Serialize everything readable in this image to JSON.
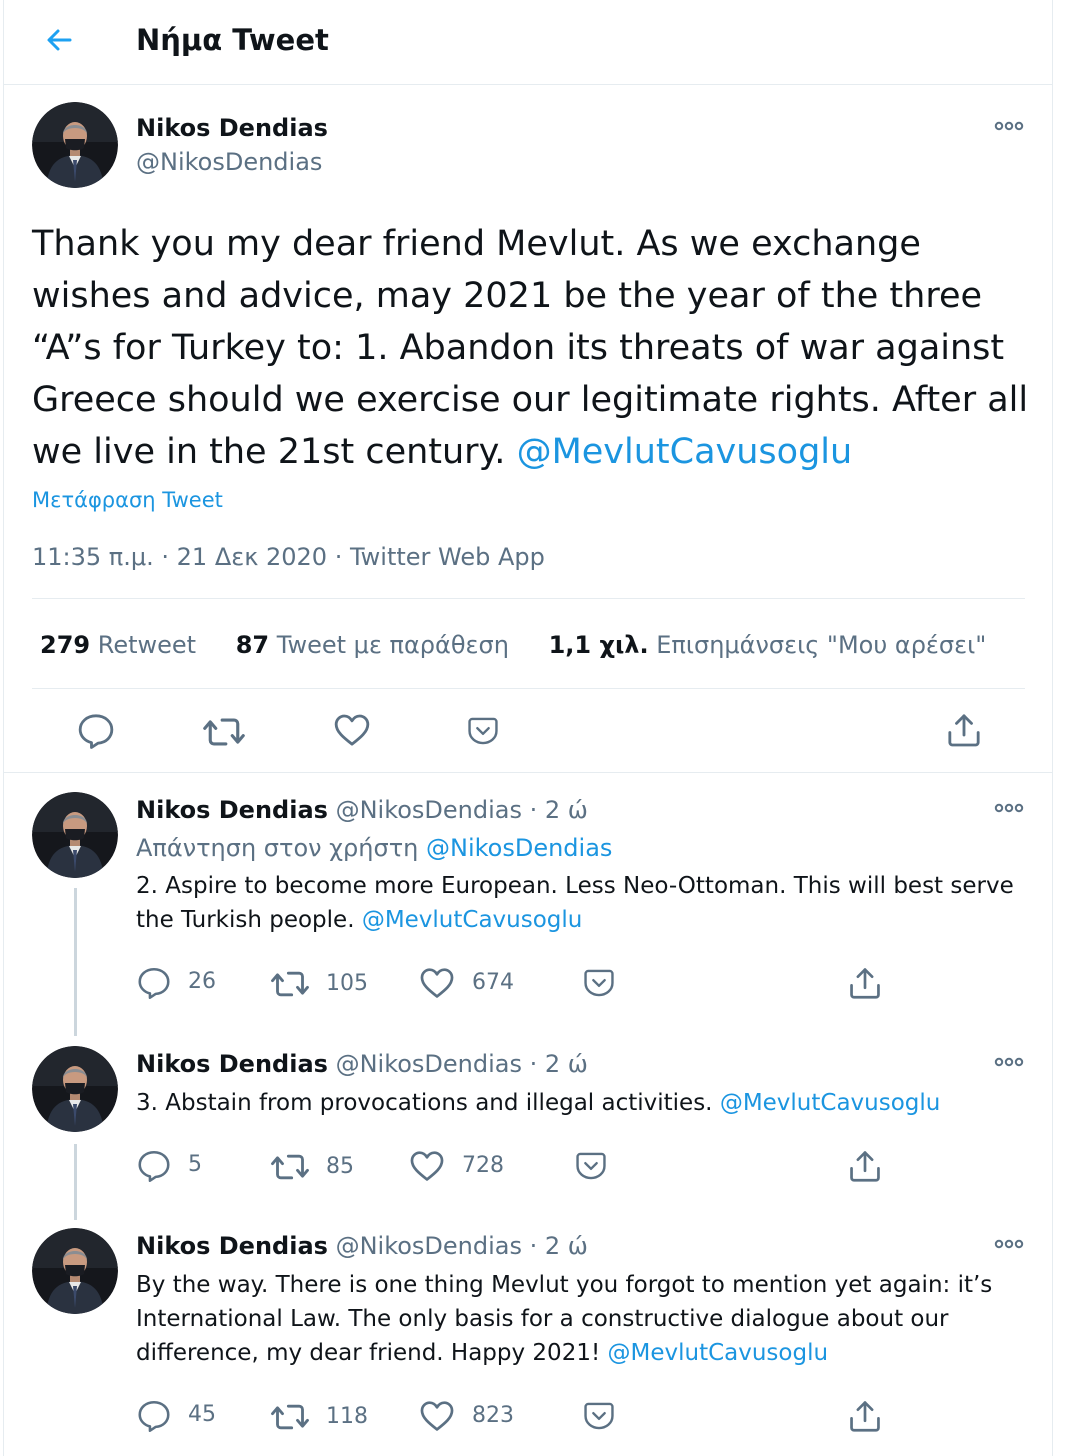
{
  "header": {
    "title": "Νήμα Tweet",
    "back_icon": "arrow-left-icon"
  },
  "colors": {
    "accent": "#1da1f2",
    "link": "#1b95e0",
    "secondary_text": "#5b7083",
    "divider": "#e6ecf0"
  },
  "main_tweet": {
    "author_name": "Nikos Dendias",
    "author_handle": "@NikosDendias",
    "text": "Thank you my dear friend Mevlut. As we exchange wishes and advice, may 2021 be the year of the three “A”s for Turkey to: 1. Abandon its threats of war against Greece should we exercise our legitimate rights. After all we live in the 21st century. ",
    "mention": "@MevlutCavusoglu",
    "translate_label": "Μετάφραση Tweet",
    "timestamp": "11:35 π.μ. · 21 Δεκ 2020 · Twitter Web App",
    "stats": {
      "retweets_count": "279",
      "retweets_label": "Retweet",
      "quotes_count": "87",
      "quotes_label": "Tweet με παράθεση",
      "likes_count": "1,1 χιλ.",
      "likes_label": "Επισημάνσεις \"Μου αρέσει\""
    }
  },
  "replies": [
    {
      "author_name": "Nikos Dendias",
      "author_handle": "@NikosDendias",
      "time": " · 2 ώ",
      "reply_to_label": "Απάντηση στον χρήστη ",
      "reply_to_handle": "@NikosDendias",
      "text": "2. Aspire to become more European. Less Neo-Ottoman. This will best serve the Turkish people. ",
      "mention": "@MevlutCavusoglu",
      "replies_count": "26",
      "retweets_count": "105",
      "likes_count": "674"
    },
    {
      "author_name": "Nikos Dendias",
      "author_handle": "@NikosDendias",
      "time": " · 2 ώ",
      "text": "3. Abstain from provocations and illegal activities. ",
      "mention": "@MevlutCavusoglu",
      "replies_count": "5",
      "retweets_count": "85",
      "likes_count": "728"
    },
    {
      "author_name": "Nikos Dendias",
      "author_handle": "@NikosDendias",
      "time": " · 2 ώ",
      "text": "By the way. There is one thing Mevlut you forgot to mention yet again: it’s International Law. The only basis for a constructive dialogue about our difference, my dear friend. Happy 2021! ",
      "mention": "@MevlutCavusoglu",
      "replies_count": "45",
      "retweets_count": "118",
      "likes_count": "823"
    }
  ]
}
